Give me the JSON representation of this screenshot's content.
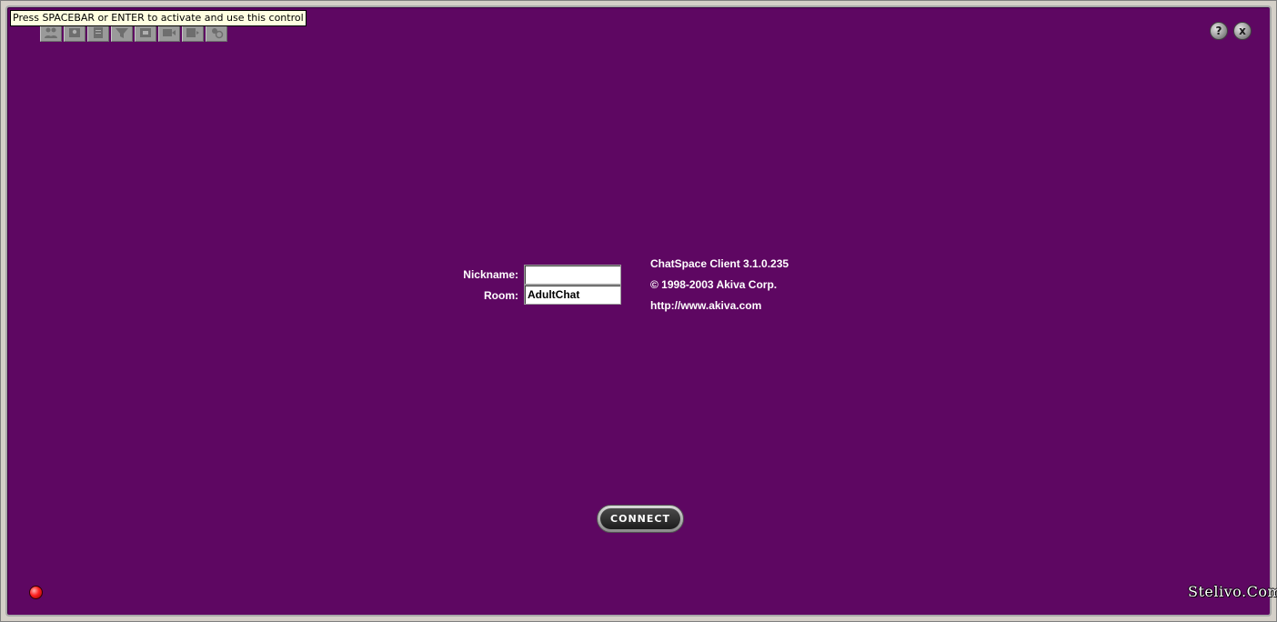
{
  "tooltip": {
    "text": "Press SPACEBAR or ENTER to activate and use this control"
  },
  "toolbar": {
    "buttons": [
      {
        "name": "people-icon"
      },
      {
        "name": "users-icon"
      },
      {
        "name": "document-icon"
      },
      {
        "name": "filter-icon"
      },
      {
        "name": "settings-icon"
      },
      {
        "name": "video-icon"
      },
      {
        "name": "list-icon"
      },
      {
        "name": "user-block-icon"
      }
    ]
  },
  "window_controls": {
    "help_label": "?",
    "close_label": "x"
  },
  "login": {
    "nickname_label": "Nickname:",
    "nickname_value": "",
    "room_label": "Room:",
    "room_value": "AdultChat"
  },
  "info": {
    "version": "ChatSpace Client 3.1.0.235",
    "copyright": "© 1998-2003 Akiva Corp.",
    "url": "http://www.akiva.com"
  },
  "connect": {
    "label": "CONNECT"
  },
  "brand": {
    "text": "Stelivo.Com"
  },
  "colors": {
    "panel_background": "#5e0762",
    "status_led": "#ff2020"
  }
}
